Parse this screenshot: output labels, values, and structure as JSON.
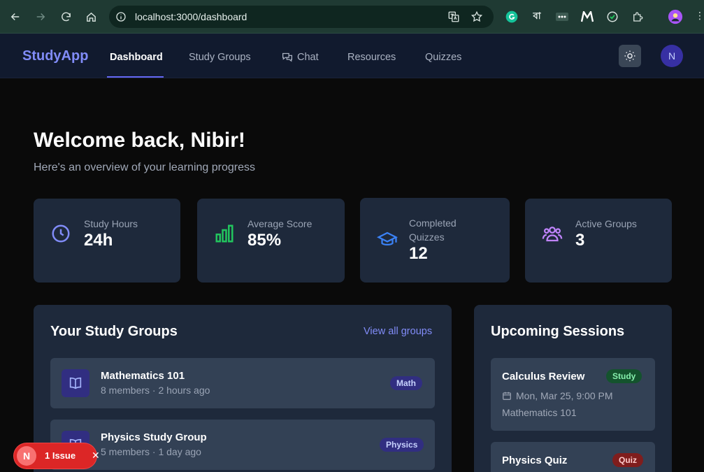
{
  "browser": {
    "url": "localhost:3000/dashboard",
    "extensions": [
      "translate-icon",
      "star-icon",
      "grammarly-icon",
      "bangla-icon",
      "dots-icon",
      "m-icon",
      "check-icon",
      "puzzle-icon",
      "profile-icon"
    ],
    "bangla_label": "বা"
  },
  "app": {
    "brand": "StudyApp",
    "nav": [
      {
        "label": "Dashboard",
        "active": true
      },
      {
        "label": "Study Groups",
        "active": false
      },
      {
        "label": "Chat",
        "active": false
      },
      {
        "label": "Resources",
        "active": false
      },
      {
        "label": "Quizzes",
        "active": false
      }
    ],
    "avatar_initial": "N"
  },
  "welcome": {
    "title": "Welcome back, Nibir!",
    "subtitle": "Here's an overview of your learning progress"
  },
  "stats": [
    {
      "label": "Study Hours",
      "value": "24h",
      "icon": "clock-icon",
      "color": "#818cf8"
    },
    {
      "label": "Average Score",
      "value": "85%",
      "icon": "bar-chart-icon",
      "color": "#22c55e"
    },
    {
      "label": "Completed Quizzes",
      "value": "12",
      "icon": "graduation-cap-icon",
      "color": "#3b82f6"
    },
    {
      "label": "Active Groups",
      "value": "3",
      "icon": "users-icon",
      "color": "#c084fc"
    }
  ],
  "study_groups": {
    "title": "Your Study Groups",
    "view_all": "View all groups",
    "items": [
      {
        "name": "Mathematics 101",
        "meta": "8 members · 2 hours ago",
        "tag": "Math"
      },
      {
        "name": "Physics Study Group",
        "meta": "5 members · 1 day ago",
        "tag": "Physics"
      }
    ]
  },
  "sessions": {
    "title": "Upcoming Sessions",
    "items": [
      {
        "name": "Calculus Review",
        "tag": "Study",
        "date": "Mon, Mar 25, 9:00 PM",
        "group": "Mathematics 101"
      },
      {
        "name": "Physics Quiz",
        "tag": "Quiz"
      }
    ]
  },
  "dev_overlay": {
    "logo": "N",
    "issues": "1 Issue"
  }
}
